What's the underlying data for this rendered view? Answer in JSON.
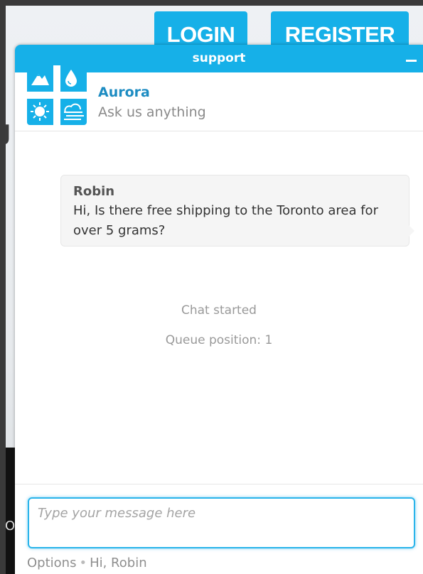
{
  "background": {
    "login_label": "LOGIN",
    "register_label": "REGISTER",
    "partial_letter_left": "J",
    "partial_letter_bottom": "O"
  },
  "chat": {
    "title": "support",
    "minimize_icon": "minimize-icon",
    "agent": {
      "name": "Aurora",
      "tagline": "Ask us anything",
      "logo_icons": [
        "mountain-icon",
        "water-drop-icon",
        "sun-icon",
        "cloud-wind-icon"
      ]
    },
    "messages": [
      {
        "author": "Robin",
        "text": "Hi, Is there free shipping to the Toronto area for over 5 grams?"
      }
    ],
    "status": {
      "started": "Chat started",
      "queue": "Queue position: 1"
    },
    "input": {
      "placeholder": "Type your message here",
      "value": ""
    },
    "footer": {
      "options_label": "Options",
      "separator": "•",
      "greeting": "Hi, Robin"
    }
  },
  "colors": {
    "accent": "#16b0e8",
    "agent_name": "#1d8cc2",
    "muted_text": "#999999"
  }
}
